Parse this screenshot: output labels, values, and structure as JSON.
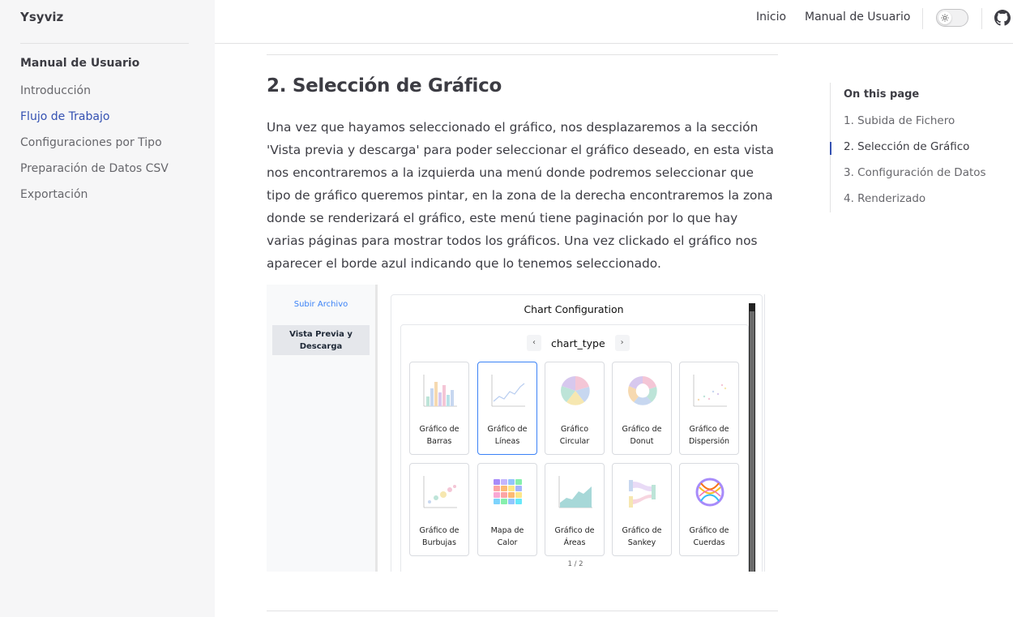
{
  "sidebar": {
    "brand": "Ysyviz",
    "section_title": "Manual de Usuario",
    "items": [
      {
        "label": "Introducción"
      },
      {
        "label": "Flujo de Trabajo"
      },
      {
        "label": "Configuraciones por Tipo"
      },
      {
        "label": "Preparación de Datos CSV"
      },
      {
        "label": "Exportación"
      }
    ],
    "active_index": 1
  },
  "topnav": {
    "links": [
      "Inicio",
      "Manual de Usuario"
    ],
    "theme_toggle_icon": "sun-icon",
    "github_icon": "github-icon"
  },
  "content": {
    "heading": "2. Selección de Gráfico",
    "paragraph": "Una vez que hayamos seleccionado el gráfico, nos desplazaremos a la sección 'Vista previa y descarga' para poder seleccionar el gráfico deseado, en esta vista nos encontraremos a la izquierda una menú donde podremos seleccionar que tipo de gráfico queremos pintar, en la zona de la derecha encontraremos la zona donde se renderizará el gráfico, este menú tiene paginación por lo que hay varias páginas para mostrar todos los gráficos. Una vez clickado el gráfico nos aparecer el borde azul indicando que lo tenemos seleccionado."
  },
  "toc": {
    "title": "On this page",
    "items": [
      "1. Subida de Fichero",
      "2. Selección de Gráfico",
      "3. Configuración de Datos",
      "4. Renderizado"
    ],
    "active_index": 1
  },
  "screenshot": {
    "side_link": "Subir Archivo",
    "side_tab_line1": "Vista Previa y",
    "side_tab_line2": "Descarga",
    "panel_title": "Chart Configuration",
    "pager_label": "chart_type",
    "pager_prev": "‹",
    "pager_next": "›",
    "page_indicator": "1 / 2",
    "cards": [
      {
        "l1": "Gráfico de",
        "l2": "Barras",
        "icon": "bar-chart-icon"
      },
      {
        "l1": "Gráfico de",
        "l2": "Líneas",
        "icon": "line-chart-icon",
        "selected": true
      },
      {
        "l1": "Gráfico",
        "l2": "Circular",
        "icon": "pie-chart-icon"
      },
      {
        "l1": "Gráfico de",
        "l2": "Donut",
        "icon": "donut-chart-icon"
      },
      {
        "l1": "Gráfico de",
        "l2": "Dispersión",
        "icon": "scatter-chart-icon"
      },
      {
        "l1": "Gráfico de",
        "l2": "Burbujas",
        "icon": "bubble-chart-icon"
      },
      {
        "l1": "Mapa de",
        "l2": "Calor",
        "icon": "heatmap-icon"
      },
      {
        "l1": "Gráfico de",
        "l2": "Áreas",
        "icon": "area-chart-icon"
      },
      {
        "l1": "Gráfico de",
        "l2": "Sankey",
        "icon": "sankey-chart-icon"
      },
      {
        "l1": "Gráfico de",
        "l2": "Cuerdas",
        "icon": "chord-chart-icon"
      }
    ],
    "accent_color": "#3b82f6"
  }
}
